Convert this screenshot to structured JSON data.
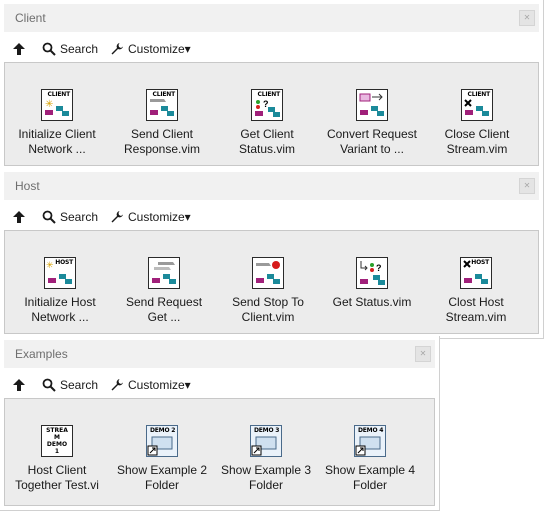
{
  "toolbar": {
    "up_label": "",
    "search_label": "Search",
    "customize_label": "Customize▾"
  },
  "palettes": [
    {
      "title": "Client",
      "items": [
        {
          "line1": "Initialize Client",
          "line2": "Network ...",
          "tag": "CLIENT"
        },
        {
          "line1": "Send Client",
          "line2": "Response.vim",
          "tag": "CLIENT"
        },
        {
          "line1": "Get Client",
          "line2": "Status.vim",
          "tag": "CLIENT"
        },
        {
          "line1": "Convert Request",
          "line2": "Variant to ...",
          "tag": ""
        },
        {
          "line1": "Close Client",
          "line2": "Stream.vim",
          "tag": "CLIENT"
        }
      ]
    },
    {
      "title": "Host",
      "items": [
        {
          "line1": "Initialize Host",
          "line2": "Network ...",
          "tag": "HOST"
        },
        {
          "line1": "Send Request",
          "line2": "Get ...",
          "tag": ""
        },
        {
          "line1": "Send Stop To",
          "line2": "Client.vim",
          "tag": ""
        },
        {
          "line1": "Get Status.vim",
          "line2": "",
          "tag": ""
        },
        {
          "line1": "Clost Host",
          "line2": "Stream.vim",
          "tag": "HOST"
        }
      ]
    },
    {
      "title": "Examples",
      "items": [
        {
          "line1": "Host Client",
          "line2": "Together Test.vi",
          "tag": "STREAM DEMO 1"
        },
        {
          "line1": "Show Example 2",
          "line2": "Folder",
          "tag": "DEMO 2"
        },
        {
          "line1": "Show Example 3",
          "line2": "Folder",
          "tag": "DEMO 3"
        },
        {
          "line1": "Show Example 4",
          "line2": "Folder",
          "tag": "DEMO 4"
        }
      ]
    }
  ],
  "colors": {
    "titlebar": "#f1f1f1",
    "content": "#ececec",
    "accent_magenta": "#a0207a",
    "accent_teal": "#1b8a9a"
  }
}
